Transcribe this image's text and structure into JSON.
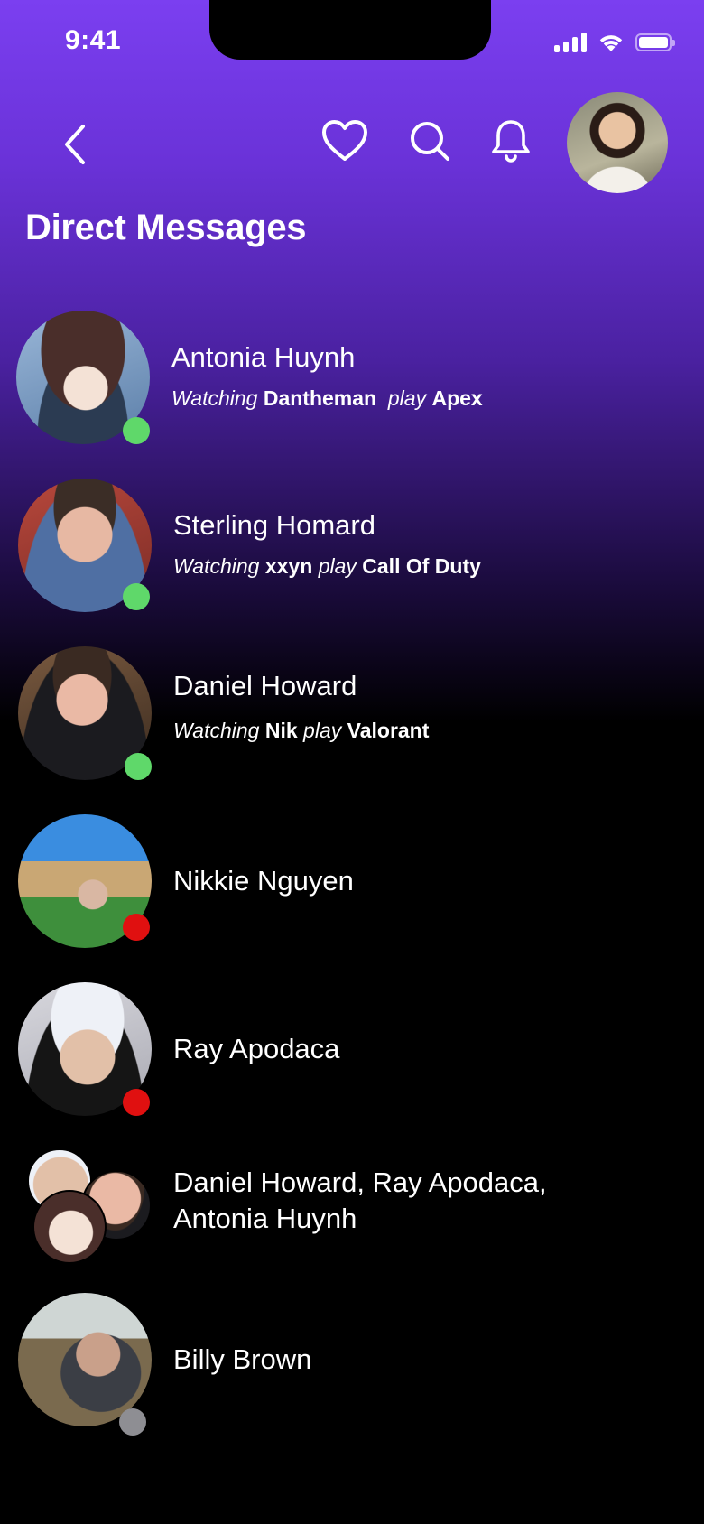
{
  "status_bar": {
    "time": "9:41",
    "icons": [
      "cellular-signal-icon",
      "wifi-icon",
      "battery-icon"
    ]
  },
  "header": {
    "back_icon": "chevron-left-icon",
    "actions": [
      "heart-icon",
      "search-icon",
      "bell-icon"
    ],
    "title": "Direct Messages"
  },
  "colors": {
    "gradient_top": "#7b3ff0",
    "online": "#5fd86a",
    "busy": "#e01010",
    "offline": "#8e8e93"
  },
  "messages": [
    {
      "name": "Antonia Huynh",
      "status": "online",
      "activity": {
        "prefix": "Watching",
        "streamer": "Dantheman",
        "verb": "play",
        "game": "Apex"
      }
    },
    {
      "name": "Sterling Homard",
      "status": "online",
      "activity": {
        "prefix": "Watching",
        "streamer": "xxyn",
        "verb": "play",
        "game": "Call Of Duty"
      }
    },
    {
      "name": "Daniel Howard",
      "status": "online",
      "activity": {
        "prefix": "Watching",
        "streamer": "Nik",
        "verb": "play",
        "game": "Valorant"
      }
    },
    {
      "name": "Nikkie Nguyen",
      "status": "busy"
    },
    {
      "name": "Ray Apodaca",
      "status": "busy"
    },
    {
      "name_line1": "Daniel Howard, Ray Apodaca,",
      "name_line2": "Antonia Huynh"
    },
    {
      "name": "Billy Brown",
      "status": "offline"
    }
  ]
}
